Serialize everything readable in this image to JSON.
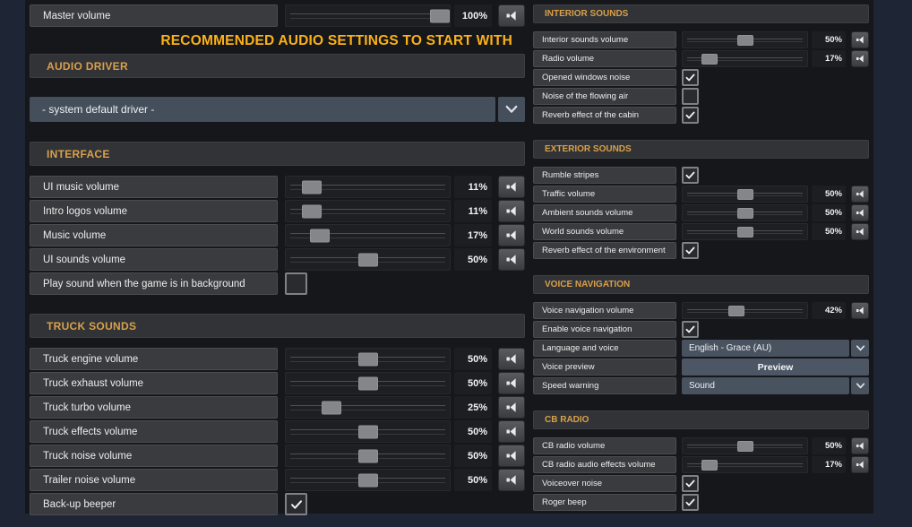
{
  "banner": {
    "text": "RECOMMENDED AUDIO SETTINGS TO START WITH"
  },
  "master": {
    "label": "Master volume",
    "pct": 100,
    "display": "100%"
  },
  "audio_driver": {
    "header": "AUDIO DRIVER",
    "selected": "- system default driver -"
  },
  "left_sections": [
    {
      "header": "INTERFACE",
      "rows": [
        {
          "type": "slider",
          "label": "UI music volume",
          "pct": 11,
          "display": "11%"
        },
        {
          "type": "slider",
          "label": "Intro logos volume",
          "pct": 11,
          "display": "11%"
        },
        {
          "type": "slider",
          "label": "Music volume",
          "pct": 17,
          "display": "17%"
        },
        {
          "type": "slider",
          "label": "UI sounds volume",
          "pct": 50,
          "display": "50%"
        },
        {
          "type": "checkbox",
          "label": "Play sound when the game is in background",
          "checked": false
        }
      ]
    },
    {
      "header": "TRUCK SOUNDS",
      "rows": [
        {
          "type": "slider",
          "label": "Truck engine volume",
          "pct": 50,
          "display": "50%"
        },
        {
          "type": "slider",
          "label": "Truck exhaust volume",
          "pct": 50,
          "display": "50%"
        },
        {
          "type": "slider",
          "label": "Truck turbo volume",
          "pct": 25,
          "display": "25%"
        },
        {
          "type": "slider",
          "label": "Truck effects volume",
          "pct": 50,
          "display": "50%"
        },
        {
          "type": "slider",
          "label": "Truck noise volume",
          "pct": 50,
          "display": "50%"
        },
        {
          "type": "slider",
          "label": "Trailer noise volume",
          "pct": 50,
          "display": "50%"
        },
        {
          "type": "checkbox",
          "label": "Back-up beeper",
          "checked": true
        }
      ]
    }
  ],
  "right_sections": [
    {
      "header": "INTERIOR SOUNDS",
      "rows": [
        {
          "type": "slider",
          "label": "Interior sounds volume",
          "pct": 50,
          "display": "50%"
        },
        {
          "type": "slider",
          "label": "Radio volume",
          "pct": 17,
          "display": "17%"
        },
        {
          "type": "checkbox",
          "label": "Opened windows noise",
          "checked": true
        },
        {
          "type": "checkbox",
          "label": "Noise of the flowing air",
          "checked": false
        },
        {
          "type": "checkbox",
          "label": "Reverb effect of the cabin",
          "checked": true
        }
      ]
    },
    {
      "header": "EXTERIOR SOUNDS",
      "rows": [
        {
          "type": "checkbox",
          "label": "Rumble stripes",
          "checked": true
        },
        {
          "type": "slider",
          "label": "Traffic volume",
          "pct": 50,
          "display": "50%"
        },
        {
          "type": "slider",
          "label": "Ambient sounds volume",
          "pct": 50,
          "display": "50%"
        },
        {
          "type": "slider",
          "label": "World sounds volume",
          "pct": 50,
          "display": "50%"
        },
        {
          "type": "checkbox",
          "label": "Reverb effect of the environment",
          "checked": true
        }
      ]
    },
    {
      "header": "VOICE NAVIGATION",
      "rows": [
        {
          "type": "slider",
          "label": "Voice navigation volume",
          "pct": 42,
          "display": "42%"
        },
        {
          "type": "checkbox",
          "label": "Enable voice navigation",
          "checked": true
        },
        {
          "type": "dropdown",
          "label": "Language and voice",
          "value": "English - Grace (AU)"
        },
        {
          "type": "button",
          "label": "Voice preview",
          "button": "Preview"
        },
        {
          "type": "dropdown",
          "label": "Speed warning",
          "value": "Sound"
        }
      ]
    },
    {
      "header": "CB RADIO",
      "rows": [
        {
          "type": "slider",
          "label": "CB radio volume",
          "pct": 50,
          "display": "50%"
        },
        {
          "type": "slider",
          "label": "CB radio audio effects volume",
          "pct": 17,
          "display": "17%"
        },
        {
          "type": "checkbox",
          "label": "Voiceover noise",
          "checked": true
        },
        {
          "type": "checkbox",
          "label": "Roger beep",
          "checked": true
        }
      ]
    }
  ],
  "colors": {
    "accent_header": "#d9a049",
    "banner_text": "#fdb117",
    "panel_bg": "#15171a",
    "edge_bg": "#1e2635",
    "label_box": "#3a3b3e",
    "dropdown": "#49525f",
    "slider_handle": "#85868a"
  },
  "icons": {
    "speaker": "speaker-icon",
    "chevron": "chevron-down-icon",
    "check": "checkmark-icon"
  }
}
